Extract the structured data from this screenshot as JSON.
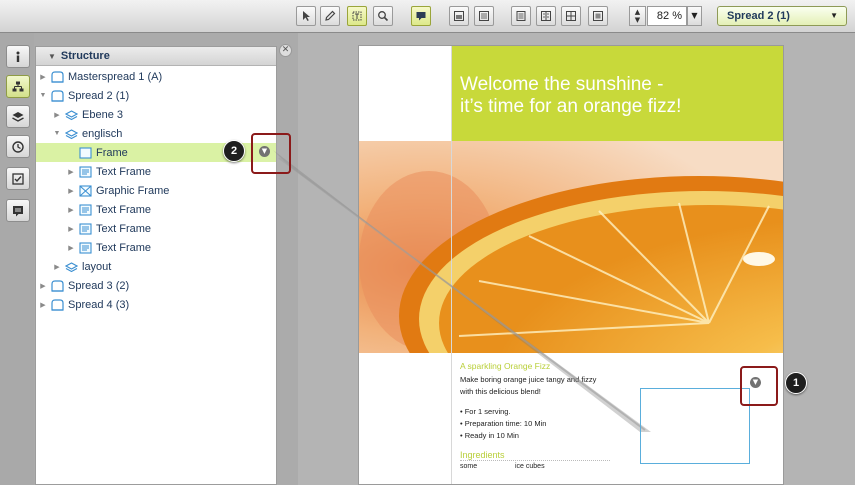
{
  "toolbar": {
    "tools": [
      {
        "icon": "select-arrow-icon"
      },
      {
        "icon": "pencil-icon"
      },
      {
        "icon": "text-frame-icon"
      },
      {
        "icon": "zoom-magnifier-icon"
      },
      {
        "icon": "comment-icon"
      },
      {
        "icon": "image-view-icon"
      },
      {
        "icon": "layout-view-icon"
      },
      {
        "icon": "single-page-icon"
      },
      {
        "icon": "double-page-icon"
      },
      {
        "icon": "grid-view-icon"
      },
      {
        "icon": "fit-page-icon"
      }
    ],
    "zoom_value": "82 %",
    "spread_selected": "Spread 2 (1)"
  },
  "rail": {
    "items": [
      {
        "icon": "info-icon"
      },
      {
        "icon": "structure-icon"
      },
      {
        "icon": "layers-icon"
      },
      {
        "icon": "history-icon"
      },
      {
        "icon": "checklist-icon"
      },
      {
        "icon": "notes-icon"
      }
    ]
  },
  "structure_panel": {
    "title": "Structure",
    "items": [
      {
        "label": "Masterspread 1 (A)",
        "level": 0,
        "expanded": false,
        "type": "spread"
      },
      {
        "label": "Spread 2 (1)",
        "level": 0,
        "expanded": true,
        "type": "spread"
      },
      {
        "label": "Ebene 3",
        "level": 1,
        "expanded": false,
        "type": "layer"
      },
      {
        "label": "englisch",
        "level": 1,
        "expanded": true,
        "type": "layer"
      },
      {
        "label": "Frame",
        "level": 2,
        "expanded": false,
        "type": "frame",
        "selected": true
      },
      {
        "label": "Text Frame",
        "level": 2,
        "expanded": false,
        "type": "text"
      },
      {
        "label": "Graphic Frame",
        "level": 2,
        "expanded": false,
        "type": "graphic"
      },
      {
        "label": "Text Frame",
        "level": 2,
        "expanded": false,
        "type": "text"
      },
      {
        "label": "Text Frame",
        "level": 2,
        "expanded": false,
        "type": "text"
      },
      {
        "label": "Text Frame",
        "level": 2,
        "expanded": false,
        "type": "text"
      },
      {
        "label": "layout",
        "level": 1,
        "expanded": false,
        "type": "layer"
      },
      {
        "label": "Spread 3 (2)",
        "level": 0,
        "expanded": false,
        "type": "spread"
      },
      {
        "label": "Spread 4 (3)",
        "level": 0,
        "expanded": false,
        "type": "spread"
      }
    ]
  },
  "document": {
    "headline_line1": "Welcome the sunshine -",
    "headline_line2": "it’s time for an orange fizz!",
    "subtitle": "A sparkling Orange Fizz",
    "intro_line1": "Make boring orange juice tangy and fizzy",
    "intro_line2": "with this delicious blend!",
    "bullet1": "• For 1 serving.",
    "bullet2": "• Preparation time: 10 Min",
    "bullet3": "• Ready in 10 Min",
    "ingredients_title": "Ingredients",
    "ingredient_qty": "some",
    "ingredient_name": "ice cubes"
  },
  "callouts": {
    "one": "1",
    "two": "2"
  },
  "colors": {
    "accent_green": "#c8d93a",
    "selection_green": "#daf2a4",
    "callout_red": "#8b1a1a",
    "frame_blue": "#5aaedc"
  }
}
